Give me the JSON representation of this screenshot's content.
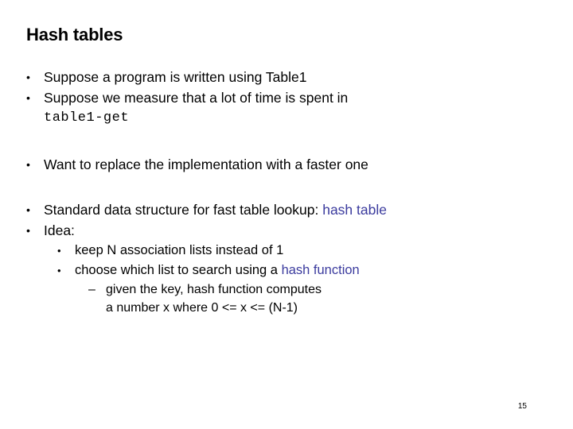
{
  "slide": {
    "title": "Hash tables",
    "page_number": "15",
    "accent_color": "#3b3b9e",
    "background_color": "#ffffff",
    "text_color": "#000000",
    "bullet_glyph": "•",
    "dash_glyph": "–",
    "bullets": [
      {
        "level": 1,
        "marker": "•",
        "text": "Suppose a program is written using Table1"
      },
      {
        "level": 1,
        "marker": "•",
        "text": "Suppose we measure that a lot of time is spent in"
      },
      {
        "level": 1,
        "marker": "",
        "text": "table1-get",
        "style": "monospace"
      },
      {
        "level": 1,
        "marker": "•",
        "text": "Want to replace the implementation with a faster one"
      },
      {
        "level": 1,
        "marker": "•",
        "text": "Standard data structure for fast table lookup: ",
        "accent_text": "hash table"
      },
      {
        "level": 1,
        "marker": "•",
        "text": "Idea:"
      },
      {
        "level": 2,
        "marker": "•",
        "text": "keep N association lists instead of 1"
      },
      {
        "level": 2,
        "marker": "•",
        "text": "choose which list to search using a ",
        "accent_text": "hash function"
      },
      {
        "level": 3,
        "marker": "–",
        "text": "given the key, hash function computes",
        "continuation": "a number x  where 0 <= x <= (N-1)"
      }
    ]
  }
}
